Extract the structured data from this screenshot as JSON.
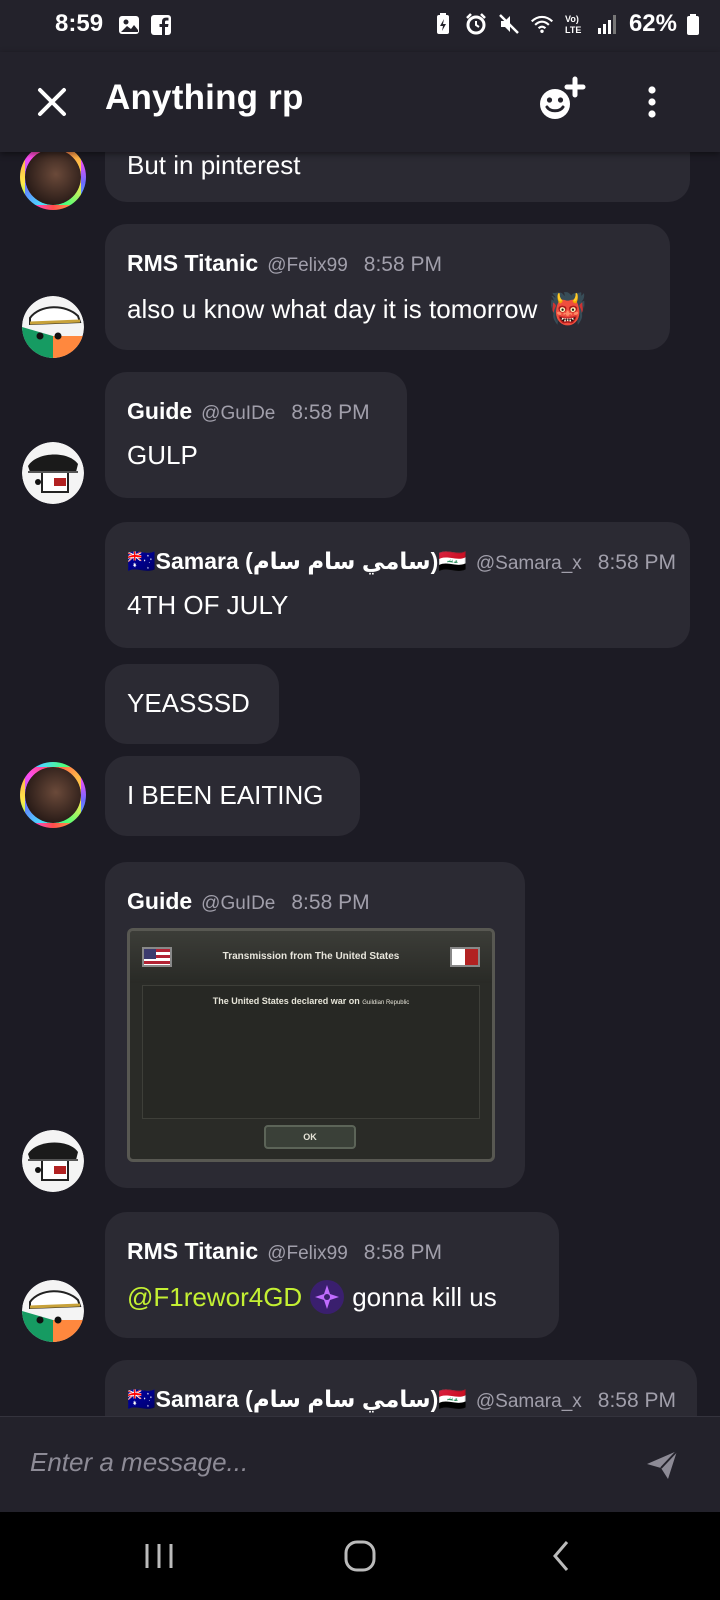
{
  "status_bar": {
    "time": "8:59",
    "battery": "62%"
  },
  "header": {
    "title": "Anything rp"
  },
  "messages": [
    {
      "text": "But in pinterest"
    },
    {
      "name": "RMS Titanic",
      "handle": "@Felix99",
      "time": "8:58 PM",
      "text": "also u know what day it is tomorrow",
      "emoji": "👹"
    },
    {
      "name": "Guide",
      "handle": "@GuIDe",
      "time": "8:58 PM",
      "text": "GULP"
    },
    {
      "name": "🇦🇺Samara (سامي سام سام)🇮🇶",
      "handle": "@Samara_x",
      "time": "8:58 PM",
      "text": "4TH OF JULY"
    },
    {
      "text": "YEASSSD"
    },
    {
      "text": "I BEEN EAITING"
    },
    {
      "name": "Guide",
      "handle": "@GuIDe",
      "time": "8:58 PM",
      "attachment": {
        "title": "Transmission from The United States",
        "body": "The United States declared war on",
        "target": "Guildian Republic",
        "button": "OK"
      }
    },
    {
      "name": "RMS Titanic",
      "handle": "@Felix99",
      "time": "8:58 PM",
      "mention": "@F1rewor4GD",
      "text": "gonna kill us"
    },
    {
      "name": "🇦🇺Samara (سامي سام سام)🇮🇶",
      "handle": "@Samara_x",
      "time": "8:58 PM"
    }
  ],
  "composer": {
    "placeholder": "Enter a message..."
  },
  "colors": {
    "background": "#1c1b24",
    "bubble": "#2b2a33",
    "mention": "#c4f033"
  }
}
